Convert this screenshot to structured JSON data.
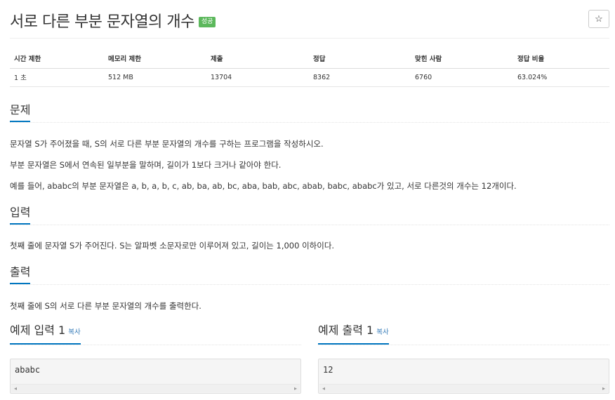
{
  "problem": {
    "title": "서로 다른 부분 문자열의 개수",
    "status_badge": "성공",
    "star_icon": "☆"
  },
  "stats": {
    "headers": [
      "시간 제한",
      "메모리 제한",
      "제출",
      "정답",
      "맞힌 사람",
      "정답 비율"
    ],
    "values": [
      "1 초",
      "512 MB",
      "13704",
      "8362",
      "6760",
      "63.024%"
    ]
  },
  "sections": {
    "description": {
      "heading": "문제",
      "paragraphs": [
        "문자열 S가 주어졌을 때, S의 서로 다른 부분 문자열의 개수를 구하는 프로그램을 작성하시오.",
        "부분 문자열은 S에서 연속된 일부분을 말하며, 길이가 1보다 크거나 같아야 한다.",
        "예를 들어, ababc의 부분 문자열은 a, b, a, b, c, ab, ba, ab, bc, aba, bab, abc, abab, babc, ababc가 있고, 서로 다른것의 개수는 12개이다."
      ]
    },
    "input": {
      "heading": "입력",
      "paragraphs": [
        "첫째 줄에 문자열 S가 주어진다. S는 알파벳 소문자로만 이루어져 있고, 길이는 1,000 이하이다."
      ]
    },
    "output": {
      "heading": "출력",
      "paragraphs": [
        "첫째 줄에 S의 서로 다른 부분 문자열의 개수를 출력한다."
      ]
    }
  },
  "samples": {
    "input": {
      "heading": "예제 입력 1",
      "copy_label": "복사",
      "content": "ababc"
    },
    "output": {
      "heading": "예제 출력 1",
      "copy_label": "복사",
      "content": "12"
    },
    "scroll_left_icon": "◂",
    "scroll_right_icon": "▸"
  }
}
